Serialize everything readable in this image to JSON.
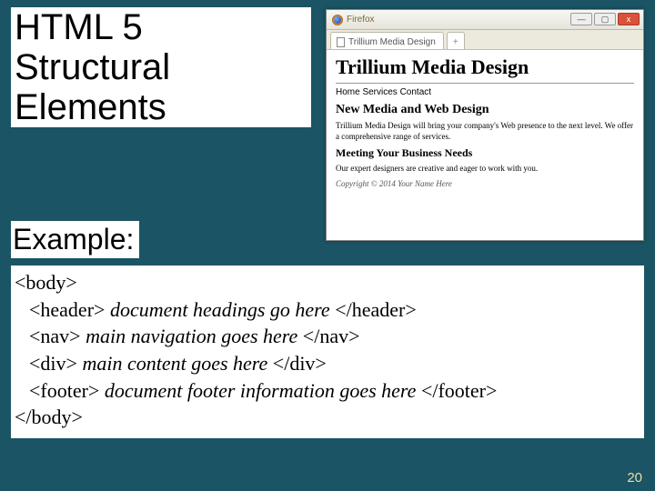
{
  "slide": {
    "title_line1": "HTML 5 Structural",
    "title_line2": " Elements",
    "example_label": "Example:",
    "page_number": "20"
  },
  "code": {
    "l1": "<body>",
    "l2_tag_open": "<header>",
    "l2_text": " document headings go here ",
    "l2_tag_close": "</header>",
    "l3_tag_open": "<nav>",
    "l3_text": " main navigation goes here ",
    "l3_tag_close": "</nav>",
    "l4_tag_open": "<div>",
    "l4_text": " main content goes here ",
    "l4_tag_close": "</div>",
    "l5_tag_open": "<footer>",
    "l5_text": "  document footer information goes here ",
    "l5_tag_close": "</footer>",
    "l6": "</body>"
  },
  "browser": {
    "app_name": "Firefox",
    "win_min": "—",
    "win_max": "▢",
    "win_close": "x",
    "tab_title": "Trillium Media Design",
    "tab_new": "+",
    "page_title": "Trillium Media Design",
    "nav_items": "Home   Services   Contact",
    "h2": "New Media and Web Design",
    "p1": "Trillium Media Design will bring your company's Web presence to the next level. We offer a comprehensive range of services.",
    "h3": "Meeting Your Business Needs",
    "p2": "Our expert designers are creative and eager to work with you.",
    "copyright": "Copyright © 2014 Your Name Here"
  }
}
